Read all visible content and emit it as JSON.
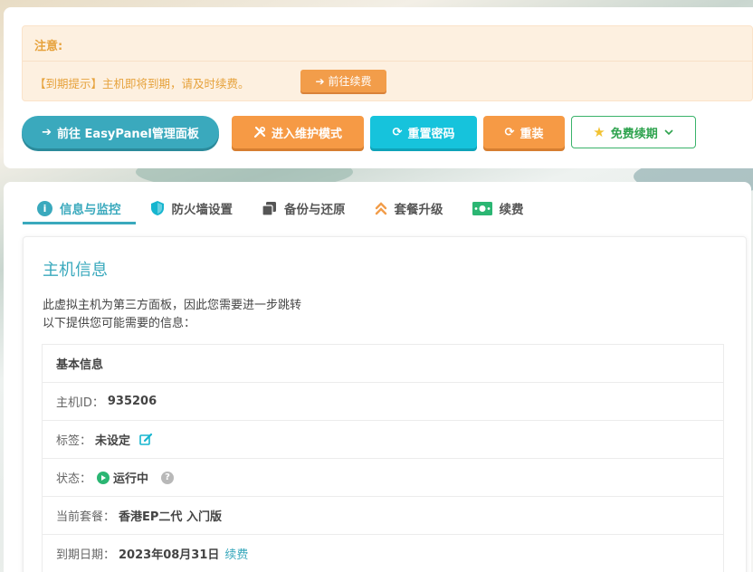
{
  "notice": {
    "title": "注意:",
    "text": "【到期提示】主机即将到期，请及时续费。",
    "button_label": "前往续费"
  },
  "actions": {
    "easypanel": "前往 EasyPanel管理面板",
    "maintenance": "进入维护模式",
    "reset_password": "重置密码",
    "reinstall": "重装",
    "free_renew": "免费续期"
  },
  "tabs": [
    {
      "label": "信息与监控",
      "icon": "info-icon"
    },
    {
      "label": "防火墙设置",
      "icon": "shield-icon"
    },
    {
      "label": "备份与还原",
      "icon": "copy-icon"
    },
    {
      "label": "套餐升级",
      "icon": "double-chevron-up-icon"
    },
    {
      "label": "续费",
      "icon": "money-icon"
    }
  ],
  "card": {
    "title": "主机信息",
    "desc_line1": "此虚拟主机为第三方面板，因此您需要进一步跳转",
    "desc_line2": "以下提供您可能需要的信息："
  },
  "info": {
    "header": "基本信息",
    "host_id_label": "主机ID：",
    "host_id": "935206",
    "tag_label": "标签：",
    "tag_value": "未设定",
    "status_label": "状态：",
    "status_value": "运行中",
    "plan_label": "当前套餐：",
    "plan_value": "香港EP二代 入门版",
    "expiry_label": "到期日期：",
    "expiry_value": "2023年08月31日",
    "renew_link": "续费"
  },
  "colors": {
    "accent": "#3aa9bd",
    "warning": "#f69a45",
    "cyan": "#16c3dc",
    "success": "#2ea34e"
  }
}
